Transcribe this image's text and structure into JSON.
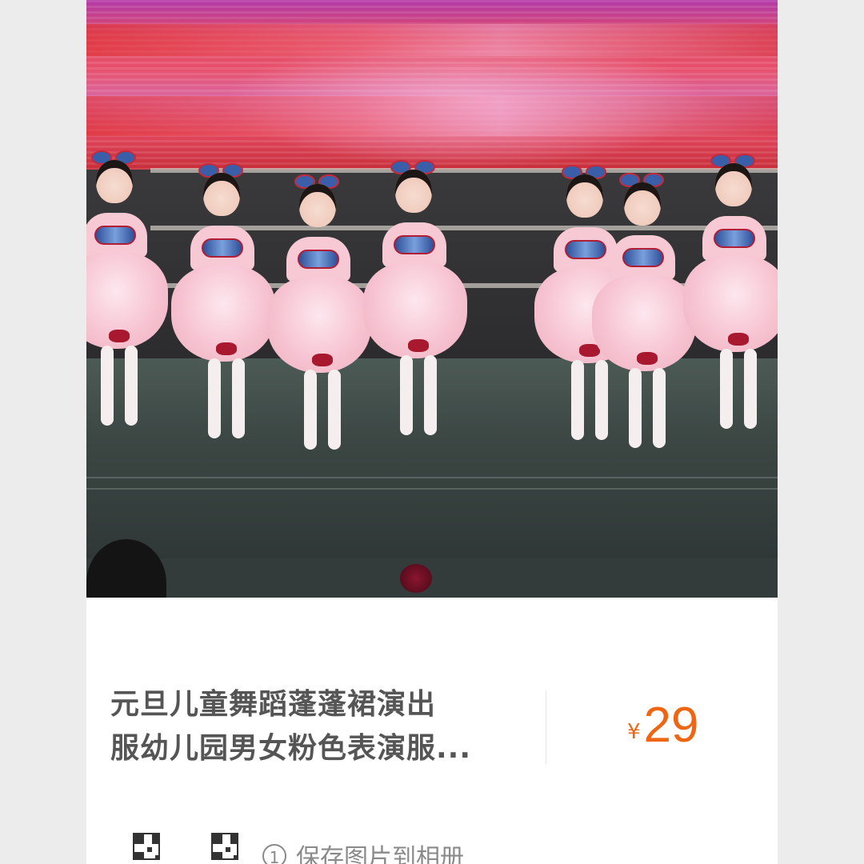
{
  "product": {
    "title_line1": "元旦儿童舞蹈蓬蓬裙演出",
    "title_line2": "服幼儿园男女粉色表演服...",
    "price_currency": "¥",
    "price_amount": "29",
    "price_color": "#ee6512"
  },
  "footer": {
    "step_number": "1",
    "save_hint": "保存图片到相册",
    "qr_icons": [
      "qr-code-icon",
      "qr-code-icon"
    ]
  },
  "photo": {
    "description_icon": "product-photo"
  }
}
